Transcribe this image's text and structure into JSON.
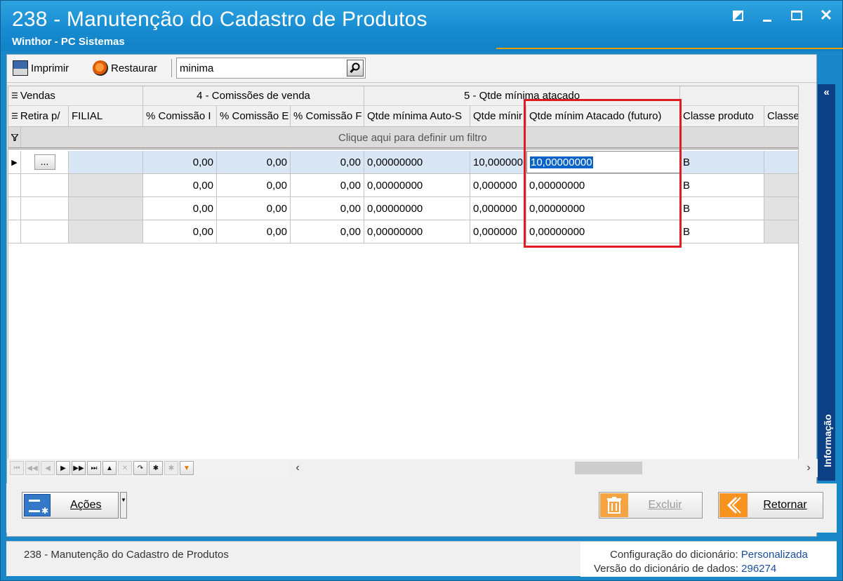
{
  "window": {
    "title": "238 - Manutenção do Cadastro de Produtos",
    "subtitle": "Winthor - PC Sistemas",
    "restore_glyph": "",
    "minimize_glyph": "",
    "maximize_glyph": "",
    "close_glyph": "✕"
  },
  "toolbar": {
    "print_label": "Imprimir",
    "restore_label": "Restaurar",
    "search_value": "minima"
  },
  "grid": {
    "bands": [
      {
        "label": "Vendas"
      },
      {
        "label": "4 - Comissões de venda"
      },
      {
        "label": "5 - Qtde mínima atacado"
      }
    ],
    "headers": [
      "Retira p/",
      "FILIAL",
      "% Comissão I",
      "% Comissão E",
      "% Comissão F",
      "Qtde mínima Auto-S",
      "Qtde mínir",
      "Qtde mínim Atacado (futuro)",
      "Classe produto",
      "Classe est"
    ],
    "filter_text": "Clique aqui para definir um filtro",
    "ellipsis_label": "...",
    "rows": [
      [
        "",
        "",
        "0,00",
        "0,00",
        "0,00",
        "0,00000000",
        "10,000000",
        "10,00000000",
        "B",
        ""
      ],
      [
        "",
        "",
        "0,00",
        "0,00",
        "0,00",
        "0,00000000",
        "0,000000",
        "0,00000000",
        "B",
        ""
      ],
      [
        "",
        "",
        "0,00",
        "0,00",
        "0,00",
        "0,00000000",
        "0,000000",
        "0,00000000",
        "B",
        ""
      ],
      [
        "",
        "",
        "0,00",
        "0,00",
        "0,00",
        "0,00000000",
        "0,000000",
        "0,00000000",
        "B",
        ""
      ]
    ]
  },
  "navigator": {
    "buttons": [
      "first-page",
      "prev-page",
      "prev",
      "next",
      "next-page",
      "last",
      "insert",
      "delete",
      "refresh",
      "bookmark",
      "clear-bookmark",
      "filter"
    ]
  },
  "info_panel": {
    "label": "Informação",
    "toggle": "«"
  },
  "actions": {
    "acoes_label": "Ações",
    "excluir_label": "Excluir",
    "retornar_label": "Retornar"
  },
  "status": {
    "left": "238 - Manutenção do Cadastro de Produtos",
    "config_label": "Configuração do dicionário:",
    "config_value": "Personalizada",
    "version_label": "Versão do dicionário de dados:",
    "version_value": "296274"
  },
  "colors": {
    "title_bar": "#1a87c9",
    "info_panel": "#0c3f83",
    "highlight_box": "#e11b22",
    "selection": "#0a64c8"
  }
}
